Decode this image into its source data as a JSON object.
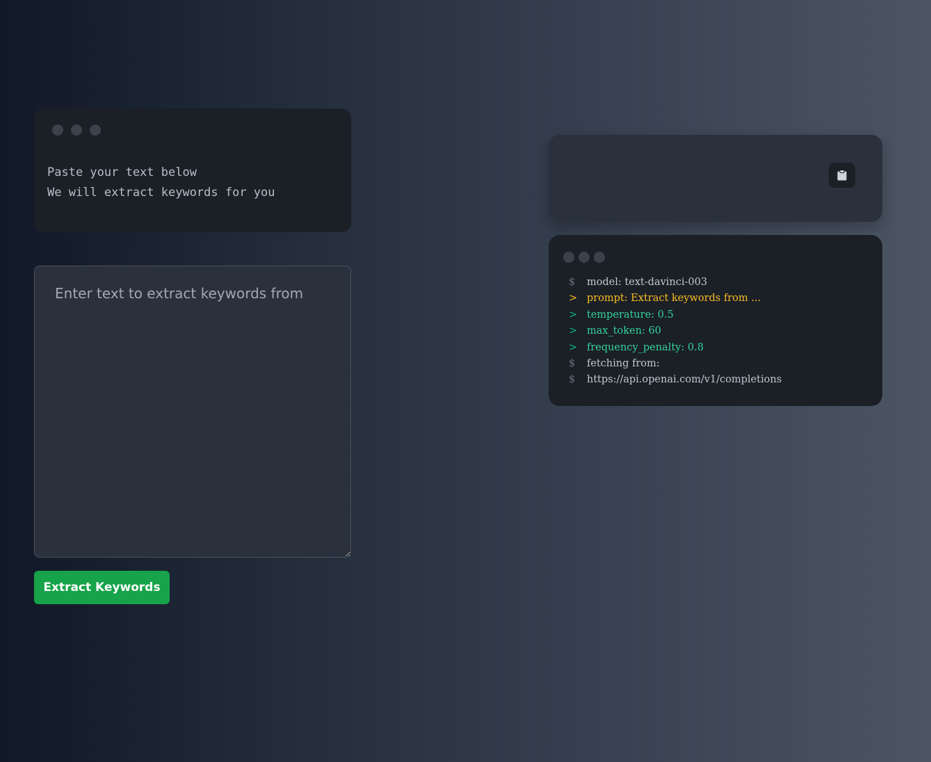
{
  "intro_card": {
    "line1": "Paste your text below",
    "line2": "We will extract keywords for you"
  },
  "input": {
    "placeholder": "Enter text to extract keywords from",
    "value": ""
  },
  "extract_button": {
    "label": "Extract Keywords"
  },
  "output": {
    "copy_icon": "clipboard-icon"
  },
  "code_card": {
    "lines": [
      {
        "prefix": "$",
        "text": "model: text-davinci-003",
        "style": "default"
      },
      {
        "prefix": ">",
        "text": "prompt: Extract keywords from ...",
        "style": "yellow"
      },
      {
        "prefix": ">",
        "text": "temperature: 0.5",
        "style": "green"
      },
      {
        "prefix": ">",
        "text": "max_token: 60",
        "style": "green"
      },
      {
        "prefix": ">",
        "text": "frequency_penalty: 0.8",
        "style": "green"
      },
      {
        "prefix": "$",
        "text": "fetching from:",
        "style": "default"
      },
      {
        "prefix": "$",
        "text": "https://api.openai.com/v1/completions",
        "style": "default"
      }
    ]
  },
  "colors": {
    "accent_button": "#16a34a",
    "prompt_yellow": "#fbbf24",
    "param_green": "#34d399",
    "card_dark": "#1b1f26",
    "card_mid": "#2a303c"
  }
}
